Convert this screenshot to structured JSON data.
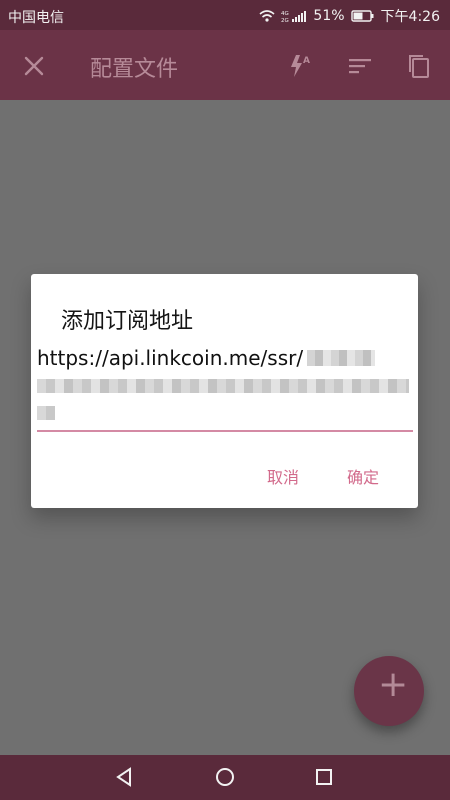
{
  "status_bar": {
    "carrier": "中国电信",
    "battery_percent": "51%",
    "time": "下午4:26"
  },
  "app_bar": {
    "title": "配置文件"
  },
  "dialog": {
    "title": "添加订阅地址",
    "url_text": "https://api.linkcoin.me/ssr/",
    "buttons": {
      "cancel": "取消",
      "ok": "确定"
    }
  },
  "icons": {
    "close": "close-icon",
    "flash_auto": "flash-auto-icon",
    "sort": "sort-icon",
    "copy": "copy-icon",
    "add": "add-icon",
    "nav_back": "back-icon",
    "nav_home": "home-icon",
    "nav_recent": "recent-icon"
  },
  "colors": {
    "status_bar": "#5a2a3b",
    "app_bar": "#6b3347",
    "dialog_button": "#d26a8b",
    "input_underline": "#d48aa4"
  }
}
